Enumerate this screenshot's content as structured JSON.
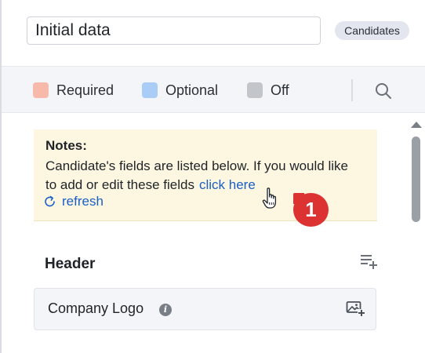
{
  "layout_name": {
    "value": "Initial data"
  },
  "module_badge": "Candidates",
  "legend": {
    "items": [
      {
        "label": "Required",
        "color": "#f7b9a9"
      },
      {
        "label": "Optional",
        "color": "#a9cdf7"
      },
      {
        "label": "Off",
        "color": "#c2c5ca"
      }
    ],
    "search_icon": "search-icon"
  },
  "notes": {
    "title": "Notes:",
    "text": "Candidate's fields are listed below. If you would like to add or edit these fields",
    "link_label": "click here",
    "refresh_label": "refresh"
  },
  "step_marker": "1",
  "section": {
    "title": "Header",
    "fields": [
      {
        "label": "Company Logo"
      }
    ]
  },
  "colors": {
    "accent_link": "#1a5fc7",
    "notes_bg": "#fdf7e1",
    "marker": "#dc3232"
  }
}
